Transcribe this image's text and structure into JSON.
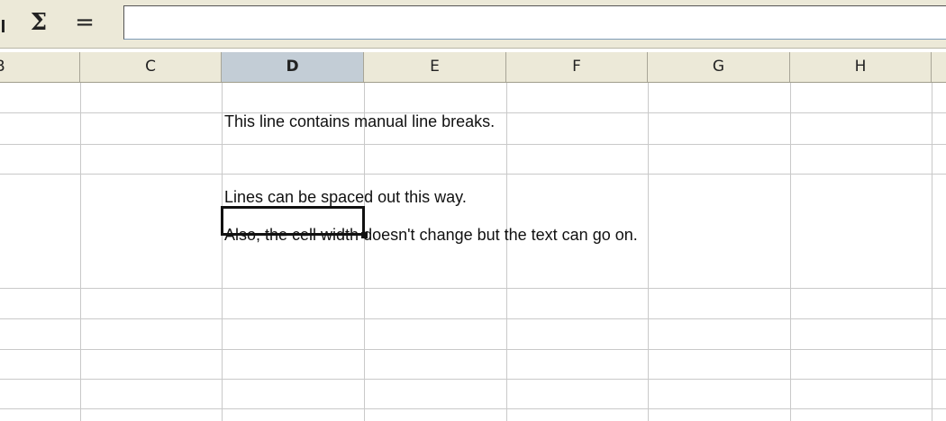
{
  "toolbar": {
    "sum_symbol": "Σ",
    "equals_symbol": "=",
    "formula_value": ""
  },
  "columns": [
    {
      "label": "B",
      "active": false
    },
    {
      "label": "C",
      "active": false
    },
    {
      "label": "D",
      "active": true
    },
    {
      "label": "E",
      "active": false
    },
    {
      "label": "F",
      "active": false
    },
    {
      "label": "G",
      "active": false
    },
    {
      "label": "H",
      "active": false
    }
  ],
  "cell": {
    "lines": [
      "This line contains manual line breaks.",
      "",
      "Lines can be spaced out this way.",
      "Also, the cell width doesn't change but the text can go on."
    ]
  },
  "colors": {
    "header_bg": "#ece9d8",
    "active_header_bg": "#c3cdd6",
    "grid_line": "#c9c9c9"
  }
}
